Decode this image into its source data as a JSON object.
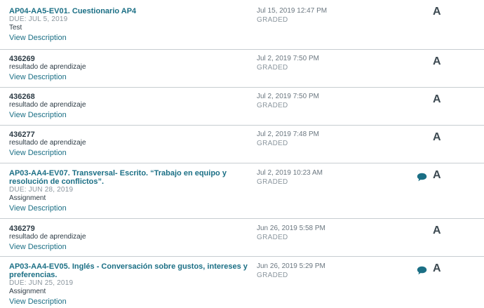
{
  "submissions": [
    {
      "title": "AP04-AA5-EV01. Cuestionario AP4",
      "due": "DUE: JUL 5, 2019",
      "context": "Test",
      "link": "View Description",
      "date": "Jul 15, 2019 12:47 PM",
      "status": "GRADED",
      "grade": "A"
    },
    {
      "title": "436269",
      "context": "resultado de aprendizaje",
      "link": "View Description",
      "date": "Jul 2, 2019 7:50 PM",
      "status": "GRADED",
      "grade": "A"
    },
    {
      "title": "436268",
      "context": "resultado de aprendizaje",
      "link": "View Description",
      "date": "Jul 2, 2019 7:50 PM",
      "status": "GRADED",
      "grade": "A"
    },
    {
      "title": "436277",
      "context": "resultado de aprendizaje",
      "link": "View Description",
      "date": "Jul 2, 2019 7:48 PM",
      "status": "GRADED",
      "grade": "A"
    },
    {
      "title": "AP03-AA4-EV07. Transversal- Escrito. “Trabajo en equipo y resolución de conflictos”.",
      "due": "DUE: JUN 28, 2019",
      "context": "Assignment",
      "link": "View Description",
      "date": "Jul 2, 2019 10:23 AM",
      "status": "GRADED",
      "grade": "A",
      "comment_icon": "comment-bubble-icon"
    },
    {
      "title": "436279",
      "context": "resultado de aprendizaje",
      "link": "View Description",
      "date": "Jun 26, 2019 5:58 PM",
      "status": "GRADED",
      "grade": "A"
    },
    {
      "title": "AP03-AA4-EV05. Inglés - Conversación sobre gustos, intereses y preferencias.",
      "due": "DUE: JUN 25, 2019",
      "context": "Assignment",
      "link": "View Description",
      "date": "Jun 26, 2019 5:29 PM",
      "status": "GRADED",
      "grade": "A",
      "comment_icon": "comment-bubble-icon"
    }
  ],
  "colors": {
    "link": "#1b6f85",
    "divider": "#c7cdd1",
    "comment_icon": "#1b6f85",
    "grade": "#3d4a52"
  }
}
